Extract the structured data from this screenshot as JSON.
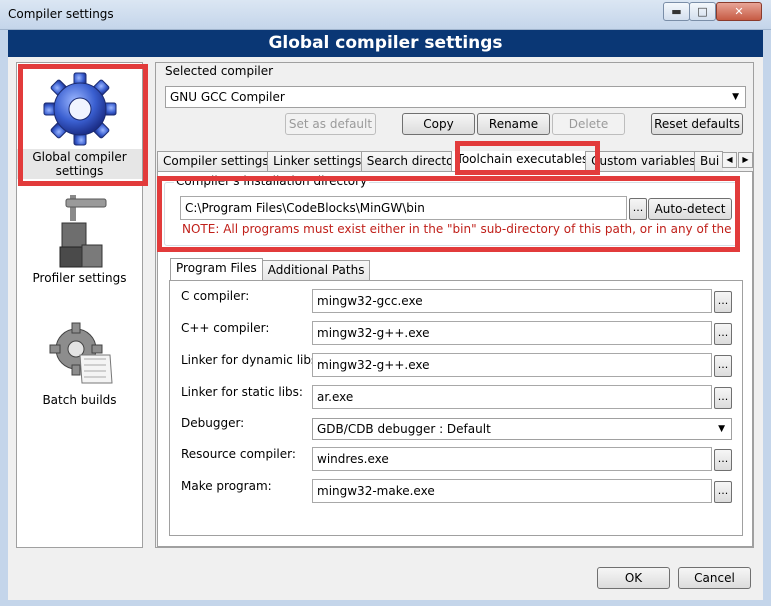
{
  "window": {
    "title": "Compiler settings",
    "controls": {
      "minimize": "▬",
      "maximize": "□",
      "close": "✕"
    }
  },
  "banner": "Global compiler settings",
  "nav": [
    {
      "label": "Global compiler settings",
      "icon": "gear-icon",
      "selected": true
    },
    {
      "label": "Profiler settings",
      "icon": "profiler-icon",
      "selected": false
    },
    {
      "label": "Batch builds",
      "icon": "batch-builds-icon",
      "selected": false
    }
  ],
  "selected_compiler": {
    "label": "Selected compiler",
    "value": "GNU GCC Compiler"
  },
  "compiler_buttons": {
    "set_default": "Set as default",
    "copy": "Copy",
    "rename": "Rename",
    "delete": "Delete",
    "reset": "Reset defaults"
  },
  "tabs": [
    "Compiler settings",
    "Linker settings",
    "Search directories",
    "Toolchain executables",
    "Custom variables",
    "Bui"
  ],
  "active_tab": "Toolchain executables",
  "install_dir": {
    "label": "Compiler's installation directory",
    "value": "C:\\Program Files\\CodeBlocks\\MinGW\\bin",
    "browse": "...",
    "auto_detect": "Auto-detect",
    "note": "NOTE: All programs must exist either in the \"bin\" sub-directory of this path, or in any of the"
  },
  "subtabs": [
    "Program Files",
    "Additional Paths"
  ],
  "programs": [
    {
      "label": "C compiler:",
      "value": "mingw32-gcc.exe"
    },
    {
      "label": "C++ compiler:",
      "value": "mingw32-g++.exe"
    },
    {
      "label": "Linker for dynamic libs:",
      "value": "mingw32-g++.exe"
    },
    {
      "label": "Linker for static libs:",
      "value": "ar.exe"
    },
    {
      "label": "Debugger:",
      "value": "GDB/CDB debugger : Default",
      "type": "dropdown"
    },
    {
      "label": "Resource compiler:",
      "value": "windres.exe"
    },
    {
      "label": "Make program:",
      "value": "mingw32-make.exe"
    }
  ],
  "footer": {
    "ok": "OK",
    "cancel": "Cancel"
  },
  "colors": {
    "banner": "#0a3775",
    "highlight": "#e23b3b",
    "note": "#c0201a"
  }
}
